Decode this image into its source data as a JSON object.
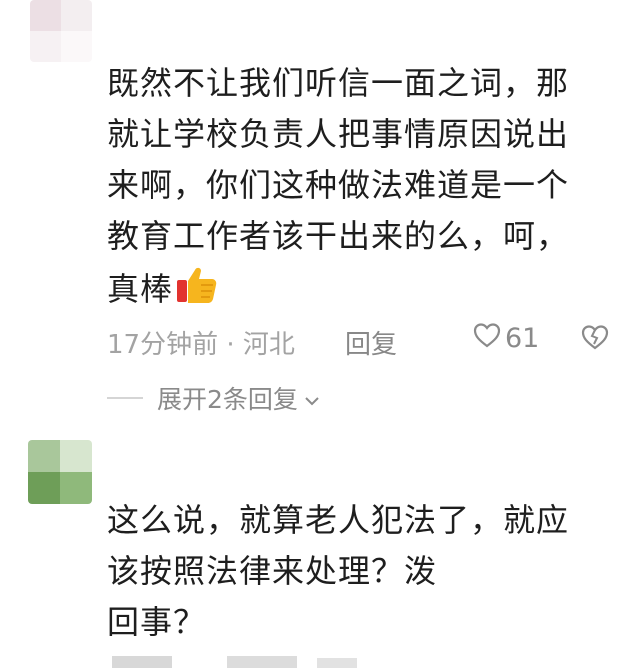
{
  "comments": [
    {
      "lines": [
        "既然不让我们听信一面之词，那",
        "就让学校负责人把事情原因说出",
        "来啊，你们这种做法难道是一个",
        "教育工作者该干出来的么，呵，",
        "真棒"
      ],
      "time_location": "17分钟前 · 河北",
      "reply_label": "回复",
      "like_count": "61",
      "expand_label": "展开2条回复"
    },
    {
      "lines": [
        "这么说，就算老人犯法了，就应",
        "该按照法律来处理？泼",
        "回事？"
      ]
    }
  ],
  "icons": {
    "thumbs": "thumbs-up-emoji",
    "heart": "heart-outline-icon",
    "dislike": "broken-heart-icon",
    "chevron": "chevron-down-icon"
  },
  "colors": {
    "text": "#1e1e1e",
    "meta": "#a3a3a3",
    "avatar_green": "#7fb06a"
  }
}
